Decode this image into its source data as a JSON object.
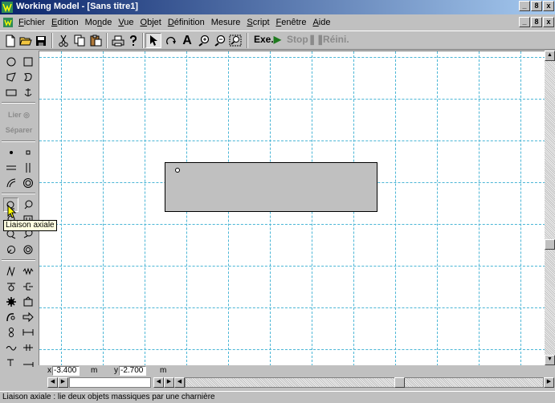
{
  "window": {
    "title": "Working Model - [Sans titre1]",
    "buttons": [
      "_",
      "8",
      "x"
    ]
  },
  "menu": {
    "items": [
      {
        "pre": "",
        "key": "F",
        "post": "ichier"
      },
      {
        "pre": "",
        "key": "E",
        "post": "dition"
      },
      {
        "pre": "Mo",
        "key": "n",
        "post": "de"
      },
      {
        "pre": "",
        "key": "V",
        "post": "ue"
      },
      {
        "pre": "",
        "key": "O",
        "post": "bjet"
      },
      {
        "pre": "",
        "key": "D",
        "post": "éfinition"
      },
      {
        "pre": "Mesure",
        "key": "",
        "post": ""
      },
      {
        "pre": "",
        "key": "S",
        "post": "cript"
      },
      {
        "pre": "",
        "key": "F",
        "post": "enêtre"
      },
      {
        "pre": "",
        "key": "A",
        "post": "ide"
      }
    ],
    "doc_buttons": [
      "_",
      "8",
      "x"
    ]
  },
  "toolbar": {
    "icons": [
      "new-file-icon",
      "open-folder-icon",
      "save-disk-icon",
      "cut-scissors-icon",
      "copy-icon",
      "paste-icon",
      "print-icon",
      "help-icon",
      "pointer-arrow-icon",
      "rotate-icon",
      "text-icon",
      "zoom-in-icon",
      "zoom-out-icon",
      "zoom-fit-icon"
    ],
    "text_tool": "A",
    "run_label": "Exe.",
    "stop_label": "Stop",
    "reset_label": "Réini."
  },
  "palette": {
    "link_label": "Lier",
    "split_label": "Séparer"
  },
  "coords": {
    "x_label": "x",
    "x_value": "-3.400",
    "x_unit": "m",
    "y_label": "y",
    "y_value": "-2.700",
    "y_unit": "m"
  },
  "tooltip": "Liaison axiale",
  "status": "Liaison axiale :  lie deux objets massiques par une charnière",
  "colors": {
    "grid": "#4bb6d6",
    "body_fill": "#c0c0c0",
    "tooltip_bg": "#ffffe1"
  }
}
